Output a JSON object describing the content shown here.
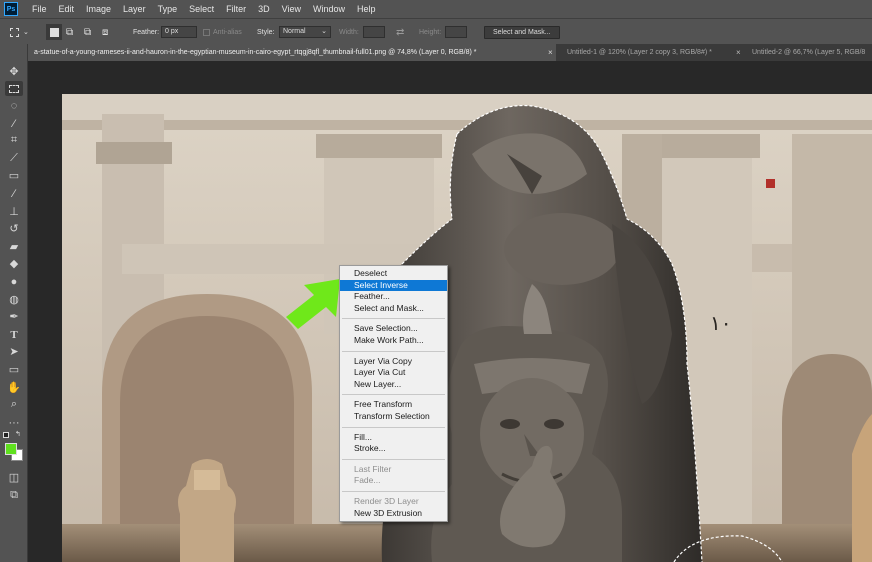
{
  "app": {
    "logo": "Ps"
  },
  "menubar": {
    "items": [
      "File",
      "Edit",
      "Image",
      "Layer",
      "Type",
      "Select",
      "Filter",
      "3D",
      "View",
      "Window",
      "Help"
    ]
  },
  "options": {
    "feather_label": "Feather:",
    "feather_value": "0 px",
    "antialias_label": "Anti-alias",
    "style_label": "Style:",
    "style_value": "Normal",
    "width_label": "Width:",
    "height_label": "Height:",
    "select_mask_label": "Select and Mask..."
  },
  "tabs": [
    {
      "label": "a-statue-of-a-young-rameses-ii-and-hauron-in-the-egyptian-museum-in-cairo-egypt_rtqgj8qfl_thumbnail-full01.png @ 74,8% (Layer 0, RGB/8) *",
      "close": "×"
    },
    {
      "label": "Untitled-1 @ 120% (Layer 2 copy 3, RGB/8#) *",
      "close": "×"
    },
    {
      "label": "Untitled-2 @ 66,7% (Layer 5, RGB/8",
      "close": ""
    }
  ],
  "toolbar": {
    "tools": [
      "move-icon",
      "marquee-icon",
      "lasso-icon",
      "magic-wand-icon",
      "crop-icon",
      "eyedropper-icon",
      "healing-icon",
      "brush-icon",
      "stamp-icon",
      "history-brush-icon",
      "eraser-icon",
      "paint-bucket-icon",
      "blur-icon",
      "dodge-icon",
      "pen-icon",
      "type-icon",
      "path-select-icon",
      "rectangle-icon",
      "hand-icon",
      "zoom-icon",
      "more-icon"
    ],
    "foreground_color": "#5fe01e",
    "background_color": "#ffffff"
  },
  "canvas": {
    "wall_sign": "١٠"
  },
  "context_menu": {
    "groups": [
      [
        {
          "label": "Deselect"
        },
        {
          "label": "Select Inverse",
          "highlighted": true
        },
        {
          "label": "Feather..."
        },
        {
          "label": "Select and Mask..."
        }
      ],
      [
        {
          "label": "Save Selection..."
        },
        {
          "label": "Make Work Path..."
        }
      ],
      [
        {
          "label": "Layer Via Copy"
        },
        {
          "label": "Layer Via Cut"
        },
        {
          "label": "New Layer..."
        }
      ],
      [
        {
          "label": "Free Transform"
        },
        {
          "label": "Transform Selection"
        }
      ],
      [
        {
          "label": "Fill..."
        },
        {
          "label": "Stroke..."
        }
      ],
      [
        {
          "label": "Last Filter",
          "disabled": true
        },
        {
          "label": "Fade...",
          "disabled": true
        }
      ],
      [
        {
          "label": "Render 3D Layer",
          "disabled": true
        },
        {
          "label": "New 3D Extrusion"
        }
      ]
    ]
  },
  "colors": {
    "accent_highlight": "#0e78d5",
    "arrow": "#6fe81a",
    "ui_panel": "#535353"
  }
}
